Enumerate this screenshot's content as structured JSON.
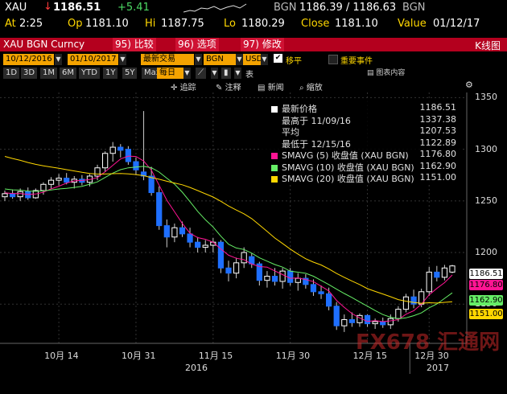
{
  "quote": {
    "ticker": "XAU",
    "arrow": "↓",
    "last": "1186.51",
    "change": "+5.41",
    "source": "BGN",
    "bid_ask": "1186.39 / 1186.63",
    "source2": "BGN",
    "time_label": "At",
    "time": "2:25",
    "op_label": "Op",
    "open": "1181.10",
    "hi_label": "Hi",
    "high": "1187.75",
    "lo_label": "Lo",
    "low": "1180.29",
    "close_label": "Close",
    "close": "1181.10",
    "value_label": "Value",
    "value_date": "01/12/17"
  },
  "toolbar": {
    "title": "XAU BGN Curncy",
    "compare": "比较",
    "compare_num": "95)",
    "options": "选项",
    "options_num": "96)",
    "edit": "修改",
    "edit_num": "97)",
    "chart_type": "K线图"
  },
  "controls": {
    "start_date": "10/12/2016",
    "end_date": "01/10/2017",
    "trade_mode": "最新交易",
    "source": "BGN",
    "currency": "USD",
    "shift_label": "移平",
    "events_label": "重要事件",
    "ranges": [
      "1D",
      "3D",
      "1M",
      "6M",
      "YTD",
      "1Y",
      "5Y",
      "Max"
    ],
    "period": "每日",
    "table_label": "表",
    "chart_content": "图表内容",
    "track": "追踪",
    "annotate": "注释",
    "news": "新闻",
    "zoom": "缩放"
  },
  "legend": {
    "items": [
      {
        "label": "最新价格",
        "value": "1186.51",
        "color": "#ffffff"
      },
      {
        "label": "最高于 11/09/16",
        "value": "1337.38",
        "color": ""
      },
      {
        "label": "平均",
        "value": "1207.53",
        "color": ""
      },
      {
        "label": "最低于 12/15/16",
        "value": "1122.89",
        "color": ""
      },
      {
        "label": "SMAVG (5) 收盘值 (XAU BGN)",
        "value": "1176.80",
        "color": "#ff1493"
      },
      {
        "label": "SMAVG (10) 收盘值 (XAU BGN)",
        "value": "1162.90",
        "color": "#66ee66"
      },
      {
        "label": "SMAVG (20) 收盘值 (XAU BGN)",
        "value": "1151.00",
        "color": "#ffd700"
      }
    ]
  },
  "price_tags": {
    "last": "1186.51",
    "sma5": "1176.80",
    "sma10": "1162.90",
    "sma20": "1151.00"
  },
  "chart_data": {
    "type": "candlestick",
    "y_ticks": [
      1150,
      1200,
      1250,
      1300,
      1350
    ],
    "ylim": [
      1112,
      1355
    ],
    "x_ticks": [
      "10月 14",
      "10月 31",
      "11月 15",
      "11月 30",
      "12月 15",
      "12月 30"
    ],
    "year_labels": [
      "2016",
      "2017"
    ],
    "grid": true,
    "candles": [
      {
        "o": 1254,
        "h": 1260,
        "l": 1250,
        "c": 1257
      },
      {
        "o": 1257,
        "h": 1261,
        "l": 1252,
        "c": 1254
      },
      {
        "o": 1254,
        "h": 1262,
        "l": 1250,
        "c": 1259
      },
      {
        "o": 1259,
        "h": 1263,
        "l": 1251,
        "c": 1253
      },
      {
        "o": 1253,
        "h": 1262,
        "l": 1252,
        "c": 1260
      },
      {
        "o": 1260,
        "h": 1268,
        "l": 1256,
        "c": 1266
      },
      {
        "o": 1266,
        "h": 1273,
        "l": 1262,
        "c": 1270
      },
      {
        "o": 1270,
        "h": 1276,
        "l": 1265,
        "c": 1272
      },
      {
        "o": 1272,
        "h": 1277,
        "l": 1266,
        "c": 1268
      },
      {
        "o": 1268,
        "h": 1274,
        "l": 1262,
        "c": 1271
      },
      {
        "o": 1271,
        "h": 1275,
        "l": 1265,
        "c": 1268
      },
      {
        "o": 1268,
        "h": 1276,
        "l": 1264,
        "c": 1274
      },
      {
        "o": 1274,
        "h": 1285,
        "l": 1270,
        "c": 1282
      },
      {
        "o": 1282,
        "h": 1298,
        "l": 1278,
        "c": 1296
      },
      {
        "o": 1296,
        "h": 1307,
        "l": 1288,
        "c": 1302
      },
      {
        "o": 1302,
        "h": 1305,
        "l": 1292,
        "c": 1299
      },
      {
        "o": 1300,
        "h": 1303,
        "l": 1285,
        "c": 1288
      },
      {
        "o": 1288,
        "h": 1292,
        "l": 1275,
        "c": 1280
      },
      {
        "o": 1278,
        "h": 1337,
        "l": 1270,
        "c": 1274
      },
      {
        "o": 1274,
        "h": 1283,
        "l": 1255,
        "c": 1258
      },
      {
        "o": 1258,
        "h": 1264,
        "l": 1222,
        "c": 1226
      },
      {
        "o": 1226,
        "h": 1232,
        "l": 1205,
        "c": 1215
      },
      {
        "o": 1215,
        "h": 1228,
        "l": 1210,
        "c": 1224
      },
      {
        "o": 1224,
        "h": 1230,
        "l": 1215,
        "c": 1218
      },
      {
        "o": 1218,
        "h": 1224,
        "l": 1205,
        "c": 1210
      },
      {
        "o": 1210,
        "h": 1215,
        "l": 1200,
        "c": 1205
      },
      {
        "o": 1205,
        "h": 1212,
        "l": 1200,
        "c": 1207
      },
      {
        "o": 1207,
        "h": 1214,
        "l": 1200,
        "c": 1210
      },
      {
        "o": 1210,
        "h": 1212,
        "l": 1180,
        "c": 1185
      },
      {
        "o": 1185,
        "h": 1192,
        "l": 1172,
        "c": 1180
      },
      {
        "o": 1180,
        "h": 1195,
        "l": 1175,
        "c": 1190
      },
      {
        "o": 1190,
        "h": 1205,
        "l": 1185,
        "c": 1200
      },
      {
        "o": 1196,
        "h": 1199,
        "l": 1185,
        "c": 1189
      },
      {
        "o": 1189,
        "h": 1191,
        "l": 1168,
        "c": 1173
      },
      {
        "o": 1173,
        "h": 1182,
        "l": 1166,
        "c": 1177
      },
      {
        "o": 1177,
        "h": 1185,
        "l": 1168,
        "c": 1172
      },
      {
        "o": 1172,
        "h": 1185,
        "l": 1165,
        "c": 1182
      },
      {
        "o": 1182,
        "h": 1185,
        "l": 1168,
        "c": 1171
      },
      {
        "o": 1171,
        "h": 1180,
        "l": 1163,
        "c": 1175
      },
      {
        "o": 1175,
        "h": 1179,
        "l": 1165,
        "c": 1169
      },
      {
        "o": 1169,
        "h": 1174,
        "l": 1158,
        "c": 1162
      },
      {
        "o": 1162,
        "h": 1168,
        "l": 1155,
        "c": 1160
      },
      {
        "o": 1160,
        "h": 1166,
        "l": 1144,
        "c": 1148
      },
      {
        "o": 1148,
        "h": 1152,
        "l": 1125,
        "c": 1129
      },
      {
        "o": 1129,
        "h": 1140,
        "l": 1123,
        "c": 1135
      },
      {
        "o": 1135,
        "h": 1142,
        "l": 1128,
        "c": 1132
      },
      {
        "o": 1132,
        "h": 1141,
        "l": 1128,
        "c": 1139
      },
      {
        "o": 1139,
        "h": 1140,
        "l": 1128,
        "c": 1131
      },
      {
        "o": 1131,
        "h": 1136,
        "l": 1126,
        "c": 1133
      },
      {
        "o": 1133,
        "h": 1137,
        "l": 1127,
        "c": 1130
      },
      {
        "o": 1130,
        "h": 1140,
        "l": 1126,
        "c": 1136
      },
      {
        "o": 1136,
        "h": 1148,
        "l": 1133,
        "c": 1145
      },
      {
        "o": 1145,
        "h": 1160,
        "l": 1142,
        "c": 1157
      },
      {
        "o": 1157,
        "h": 1164,
        "l": 1146,
        "c": 1150
      },
      {
        "o": 1150,
        "h": 1165,
        "l": 1147,
        "c": 1162
      },
      {
        "o": 1162,
        "h": 1186,
        "l": 1158,
        "c": 1181
      },
      {
        "o": 1181,
        "h": 1187,
        "l": 1172,
        "c": 1176
      },
      {
        "o": 1176,
        "h": 1188,
        "l": 1173,
        "c": 1185
      },
      {
        "o": 1181,
        "h": 1188,
        "l": 1180,
        "c": 1187
      }
    ]
  }
}
